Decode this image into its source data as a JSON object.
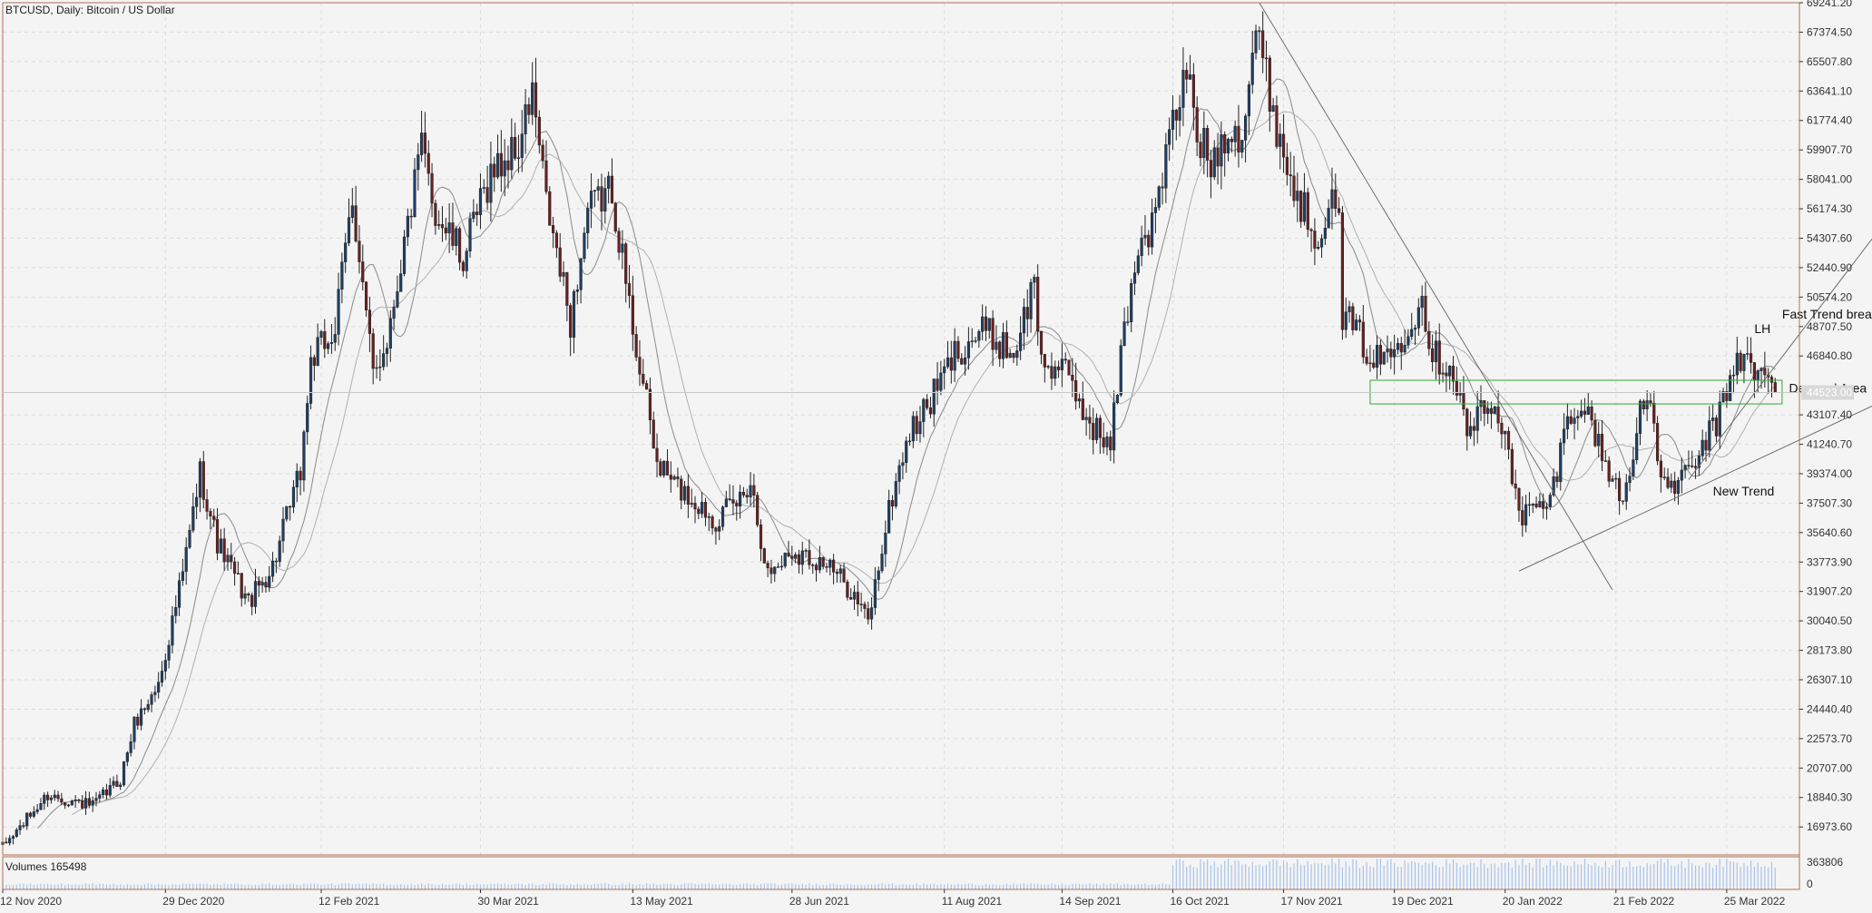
{
  "window": {
    "title": "BTCUSD, Daily:  Bitcoin / US Dollar",
    "volume_label": "Volumes 165498"
  },
  "colors": {
    "background": "#f4f4f4",
    "frame": "#b07050",
    "grid": "#dcdcdc",
    "bull_candle": "#1f3f66",
    "bear_candle": "#6b1f1f",
    "ma": "#8a8a8a",
    "trendline": "#6e6e6e",
    "demand_box": "#2faa2f",
    "volume": "#a8c4ea",
    "price_tag_bg": "#d8d8d8",
    "axis_text": "#333333"
  },
  "chart_data": {
    "type": "candlestick",
    "symbol": "BTCUSD",
    "timeframe": "Daily",
    "description": "Bitcoin / US Dollar",
    "x_range": [
      "2020-11-12",
      "2022-04-15"
    ],
    "ylim": [
      15200,
      69241.2
    ],
    "grid": true,
    "y_ticks": [
      69241.2,
      67374.5,
      65507.8,
      63641.1,
      61774.4,
      59907.7,
      58041.0,
      56174.3,
      54307.6,
      52440.9,
      50574.2,
      48707.5,
      46840.8,
      43107.4,
      41240.7,
      39374.0,
      37507.3,
      35640.6,
      33773.9,
      31907.2,
      30040.5,
      28173.8,
      26307.1,
      24440.4,
      22573.7,
      20707.0,
      18840.3,
      16973.6
    ],
    "y_tick_labels": [
      "69241.20",
      "67374.50",
      "65507.80",
      "63641.10",
      "61774.40",
      "59907.70",
      "58041.00",
      "56174.30",
      "54307.60",
      "52440.90",
      "50574.20",
      "48707.50",
      "46840.80",
      "43107.40",
      "41240.70",
      "39374.00",
      "37507.30",
      "35640.60",
      "33773.90",
      "31907.20",
      "30040.50",
      "28173.80",
      "26307.10",
      "24440.40",
      "22573.70",
      "20707.00",
      "18840.30",
      "16973.60"
    ],
    "current_price_label": "44523.00",
    "current_price": 44523.0,
    "x_ticks": [
      "2020-11-12",
      "2020-12-29",
      "2021-02-12",
      "2021-03-30",
      "2021-05-13",
      "2021-06-28",
      "2021-08-11",
      "2021-09-14",
      "2021-10-16",
      "2021-11-17",
      "2021-12-19",
      "2022-01-20",
      "2022-02-21",
      "2022-03-25"
    ],
    "x_tick_labels": [
      "12 Nov 2020",
      "29 Dec 2020",
      "12 Feb 2021",
      "30 Mar 2021",
      "13 May 2021",
      "28 Jun 2021",
      "11 Aug 2021",
      "14 Sep 2021",
      "16 Oct 2021",
      "17 Nov 2021",
      "19 Dec 2021",
      "20 Jan 2022",
      "21 Feb 2022",
      "25 Mar 2022"
    ],
    "price_path": [
      [
        "2020-11-12",
        15700
      ],
      [
        "2020-11-25",
        19000
      ],
      [
        "2020-12-08",
        18300
      ],
      [
        "2020-12-16",
        20000
      ],
      [
        "2020-12-20",
        23500
      ],
      [
        "2020-12-27",
        26000
      ],
      [
        "2021-01-03",
        33000
      ],
      [
        "2021-01-08",
        39500
      ],
      [
        "2021-01-13",
        35000
      ],
      [
        "2021-01-22",
        31200
      ],
      [
        "2021-01-29",
        33500
      ],
      [
        "2021-02-06",
        39500
      ],
      [
        "2021-02-09",
        46500
      ],
      [
        "2021-02-16",
        48500
      ],
      [
        "2021-02-21",
        57000
      ],
      [
        "2021-02-27",
        45500
      ],
      [
        "2021-03-03",
        48000
      ],
      [
        "2021-03-13",
        60000
      ],
      [
        "2021-03-17",
        56000
      ],
      [
        "2021-03-25",
        53000
      ],
      [
        "2021-04-02",
        58500
      ],
      [
        "2021-04-10",
        60000
      ],
      [
        "2021-04-14",
        63500
      ],
      [
        "2021-04-18",
        56500
      ],
      [
        "2021-04-25",
        49000
      ],
      [
        "2021-04-30",
        56000
      ],
      [
        "2021-05-07",
        57500
      ],
      [
        "2021-05-12",
        50000
      ],
      [
        "2021-05-16",
        45000
      ],
      [
        "2021-05-20",
        40000
      ],
      [
        "2021-05-26",
        38500
      ],
      [
        "2021-06-06",
        36500
      ],
      [
        "2021-06-12",
        37500
      ],
      [
        "2021-06-16",
        39000
      ],
      [
        "2021-06-21",
        33000
      ],
      [
        "2021-06-28",
        34500
      ],
      [
        "2021-07-07",
        33800
      ],
      [
        "2021-07-15",
        32000
      ],
      [
        "2021-07-20",
        30000
      ],
      [
        "2021-07-26",
        37000
      ],
      [
        "2021-07-31",
        41500
      ],
      [
        "2021-08-07",
        44000
      ],
      [
        "2021-08-14",
        47000
      ],
      [
        "2021-08-22",
        48500
      ],
      [
        "2021-08-31",
        47000
      ],
      [
        "2021-09-06",
        51500
      ],
      [
        "2021-09-08",
        46500
      ],
      [
        "2021-09-14",
        46000
      ],
      [
        "2021-09-21",
        43000
      ],
      [
        "2021-09-28",
        41000
      ],
      [
        "2021-10-01",
        47000
      ],
      [
        "2021-10-06",
        54000
      ],
      [
        "2021-10-10",
        55000
      ],
      [
        "2021-10-15",
        60500
      ],
      [
        "2021-10-20",
        65000
      ],
      [
        "2021-10-23",
        61000
      ],
      [
        "2021-10-27",
        59000
      ],
      [
        "2021-11-01",
        61500
      ],
      [
        "2021-11-05",
        61000
      ],
      [
        "2021-11-09",
        67500
      ],
      [
        "2021-11-12",
        64500
      ],
      [
        "2021-11-16",
        60500
      ],
      [
        "2021-11-19",
        58000
      ],
      [
        "2021-11-23",
        56000
      ],
      [
        "2021-11-27",
        54500
      ],
      [
        "2021-11-30",
        57000
      ],
      [
        "2021-12-03",
        55000
      ],
      [
        "2021-12-04",
        49500
      ],
      [
        "2021-12-09",
        48000
      ],
      [
        "2021-12-13",
        46500
      ],
      [
        "2021-12-18",
        47000
      ],
      [
        "2021-12-22",
        48500
      ],
      [
        "2021-12-27",
        50500
      ],
      [
        "2021-12-30",
        47000
      ],
      [
        "2022-01-05",
        46000
      ],
      [
        "2022-01-09",
        42000
      ],
      [
        "2022-01-14",
        43500
      ],
      [
        "2022-01-20",
        42500
      ],
      [
        "2022-01-24",
        36500
      ],
      [
        "2022-01-27",
        37000
      ],
      [
        "2022-02-02",
        37500
      ],
      [
        "2022-02-06",
        42000
      ],
      [
        "2022-02-10",
        44000
      ],
      [
        "2022-02-14",
        42500
      ],
      [
        "2022-02-18",
        40000
      ],
      [
        "2022-02-23",
        37500
      ],
      [
        "2022-02-28",
        43500
      ],
      [
        "2022-03-02",
        44000
      ],
      [
        "2022-03-07",
        38500
      ],
      [
        "2022-03-12",
        39000
      ],
      [
        "2022-03-15",
        39500
      ],
      [
        "2022-03-19",
        41500
      ],
      [
        "2022-03-23",
        43000
      ],
      [
        "2022-03-28",
        47000
      ],
      [
        "2022-04-01",
        46000
      ],
      [
        "2022-04-05",
        45500
      ],
      [
        "2022-04-08",
        44523
      ]
    ],
    "ma_period": 10,
    "volume": {
      "label": "Volumes",
      "current": 165498,
      "y_ticks": [
        0,
        363806
      ],
      "y_tick_labels": [
        "0",
        "363806"
      ],
      "high_phase_start": "2021-10-16",
      "high_phase_level": 300000,
      "low_phase_level": 60000
    },
    "annotations": [
      {
        "name": "annotation-lh",
        "text": "LH",
        "date": "2022-04-02",
        "price": 48300
      },
      {
        "name": "annotation-fast-trend-break",
        "text": "Fast Trend break",
        "date": "2022-04-10",
        "price": 49200
      },
      {
        "name": "annotation-demand-area",
        "text": "Demand Area",
        "date": "2022-04-12",
        "price": 44523
      },
      {
        "name": "annotation-new-trend",
        "text": "New Trend",
        "date": "2022-03-21",
        "price": 38000
      }
    ],
    "trendlines": [
      {
        "name": "descending-trendline",
        "from": [
          "2021-11-10",
          69241
        ],
        "to": [
          "2022-02-20",
          32000
        ]
      },
      {
        "name": "new-trend-line",
        "from": [
          "2022-01-24",
          33200
        ],
        "to": [
          "2022-05-18",
          44900
        ]
      },
      {
        "name": "fast-trend-line",
        "from": [
          "2022-03-14",
          39000
        ],
        "to": [
          "2022-05-12",
          56000
        ]
      }
    ],
    "demand_area": {
      "date_from": "2021-12-12",
      "date_to": "2022-04-10",
      "price_low": 43800,
      "price_high": 45300
    }
  }
}
